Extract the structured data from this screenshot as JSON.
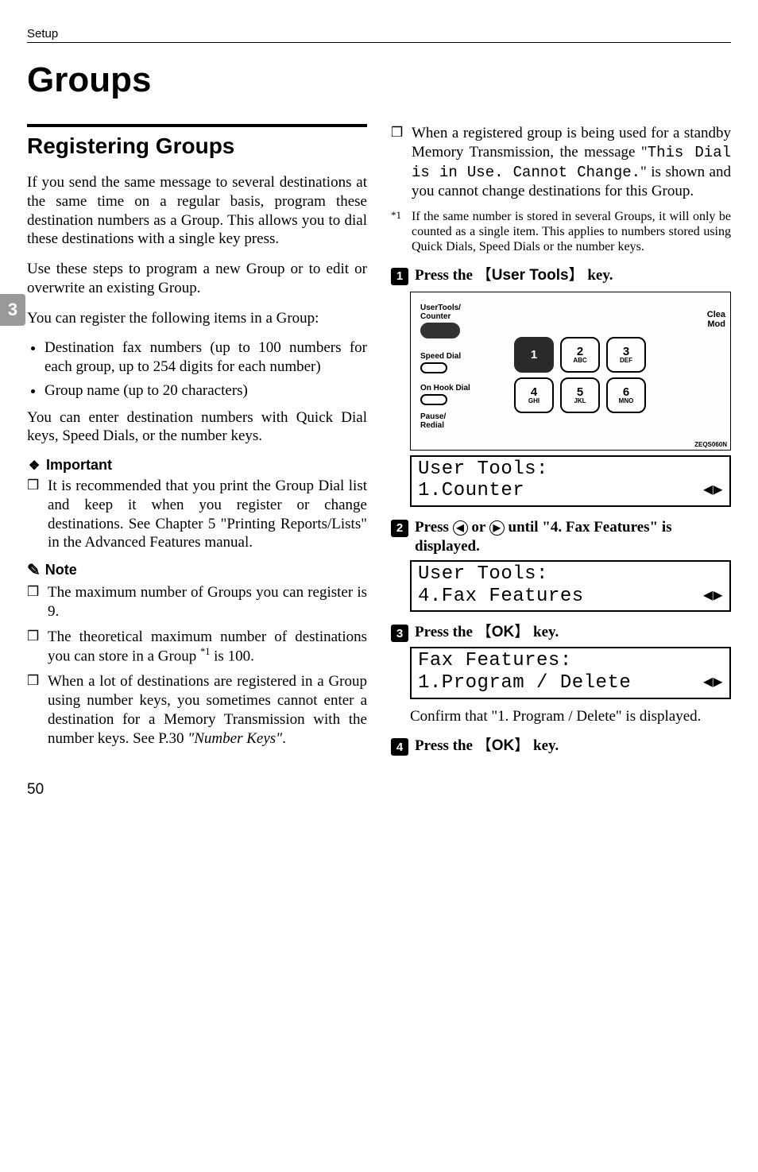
{
  "header": {
    "setup": "Setup"
  },
  "side_tab": "3",
  "title": "Groups",
  "left": {
    "subtitle": "Registering Groups",
    "p1": "If you send the same message to several destinations at the same time on a regular basis, program these destination numbers as a Group. This allows you to dial these destinations with a single key press.",
    "p2": "Use these steps to program a new Group or to edit or overwrite an existing Group.",
    "p3": "You can register the following items in a Group:",
    "bul1": "Destination fax numbers (up to 100 numbers for each group, up to 254 digits for each number)",
    "bul2": "Group name (up to 20 characters)",
    "p4": "You can enter destination numbers with Quick Dial keys, Speed Dials, or the number keys.",
    "important_label": "Important",
    "imp1": "It is recommended that you print the Group Dial list and keep it when you register or change destinations. See Chapter 5 \"Printing Reports/Lists\" in the Advanced Features manual.",
    "note_label": "Note",
    "note1": "The maximum number of Groups you can register is 9.",
    "note2a": "The theoretical maximum number of destinations you can store in a Group ",
    "note2_sup": "*1",
    "note2b": " is 100.",
    "note3a": "When a lot of destinations are registered in a Group using number keys, you sometimes cannot enter a destination for a Memory Transmission with the number keys. See P.30 ",
    "note3_ref": "\"Number Keys\"",
    "note3b": "."
  },
  "right": {
    "cb1a": "When a registered group is being used for a standby Memory Transmission, the message \"",
    "cb1_mono": "This Dial is in Use. Cannot Change.",
    "cb1b": "\" is shown and you cannot change destinations for this Group.",
    "fn_marker": "*1",
    "fn_text": "If the same number is stored in several Groups, it will only be counted as a single item. This applies to numbers stored using Quick Dials, Speed Dials or the number keys.",
    "step1_a": "Press the ",
    "step1_key": "User Tools",
    "step1_b": " key.",
    "panel": {
      "usertools": "UserTools/",
      "counter": "Counter",
      "speeddial": "Speed Dial",
      "onhook": "On Hook Dial",
      "pause": "Pause/",
      "redial": "Redial",
      "clea": "Clea",
      "mod": "Mod",
      "code": "ZEQS060N",
      "k1": "1",
      "k2": "2",
      "k2s": "ABC",
      "k3": "3",
      "k3s": "DEF",
      "k4": "4",
      "k4s": "GHI",
      "k5": "5",
      "k5s": "JKL",
      "k6": "6",
      "k6s": "MNO"
    },
    "lcd1_a": "User Tools:",
    "lcd1_b": "1.Counter",
    "step2_a": "Press ",
    "step2_b": " or ",
    "step2_c": " until \"4. Fax Features\" is displayed.",
    "lcd2_a": "User Tools:",
    "lcd2_b": "4.Fax Features",
    "step3_a": "Press the ",
    "step3_key": "OK",
    "step3_b": " key.",
    "lcd3_a": "Fax Features:",
    "lcd3_b": "1.Program / Delete",
    "confirm": "Confirm that \"1. Program / Delete\" is displayed.",
    "step4_a": "Press the ",
    "step4_key": "OK",
    "step4_b": " key."
  },
  "pagenum": "50"
}
